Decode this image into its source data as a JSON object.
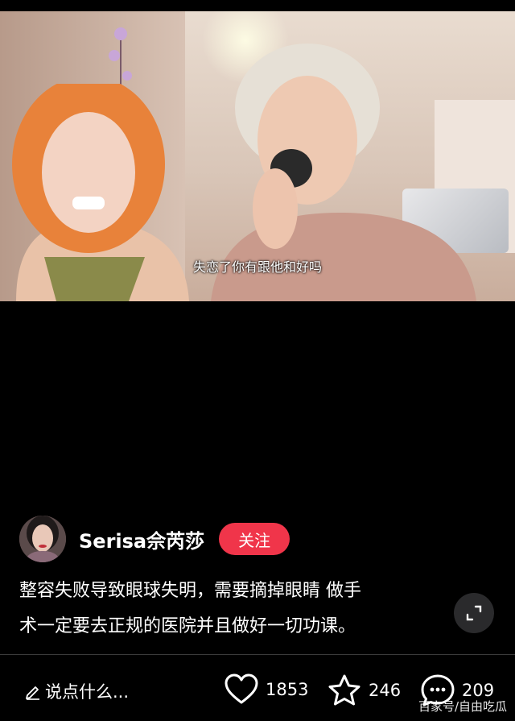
{
  "video": {
    "subtitle": "失恋了你有跟他和好吗"
  },
  "author": {
    "name": "Serisa佘芮莎",
    "follow_label": "关注"
  },
  "caption": {
    "line1": "整容失败导致眼球失明，需要摘掉眼睛 做手",
    "line2": "术一定要去正规的医院并且做好一切功课。"
  },
  "bottom_bar": {
    "comment_placeholder": "说点什么...",
    "likes": "1853",
    "favorites": "246",
    "comments": "209"
  },
  "watermark": "百家号/自由吃瓜",
  "colors": {
    "follow_button": "#f0354a",
    "background": "#000000"
  },
  "icons": [
    "pencil-icon",
    "heart-icon",
    "star-icon",
    "comment-icon",
    "expand-icon"
  ]
}
